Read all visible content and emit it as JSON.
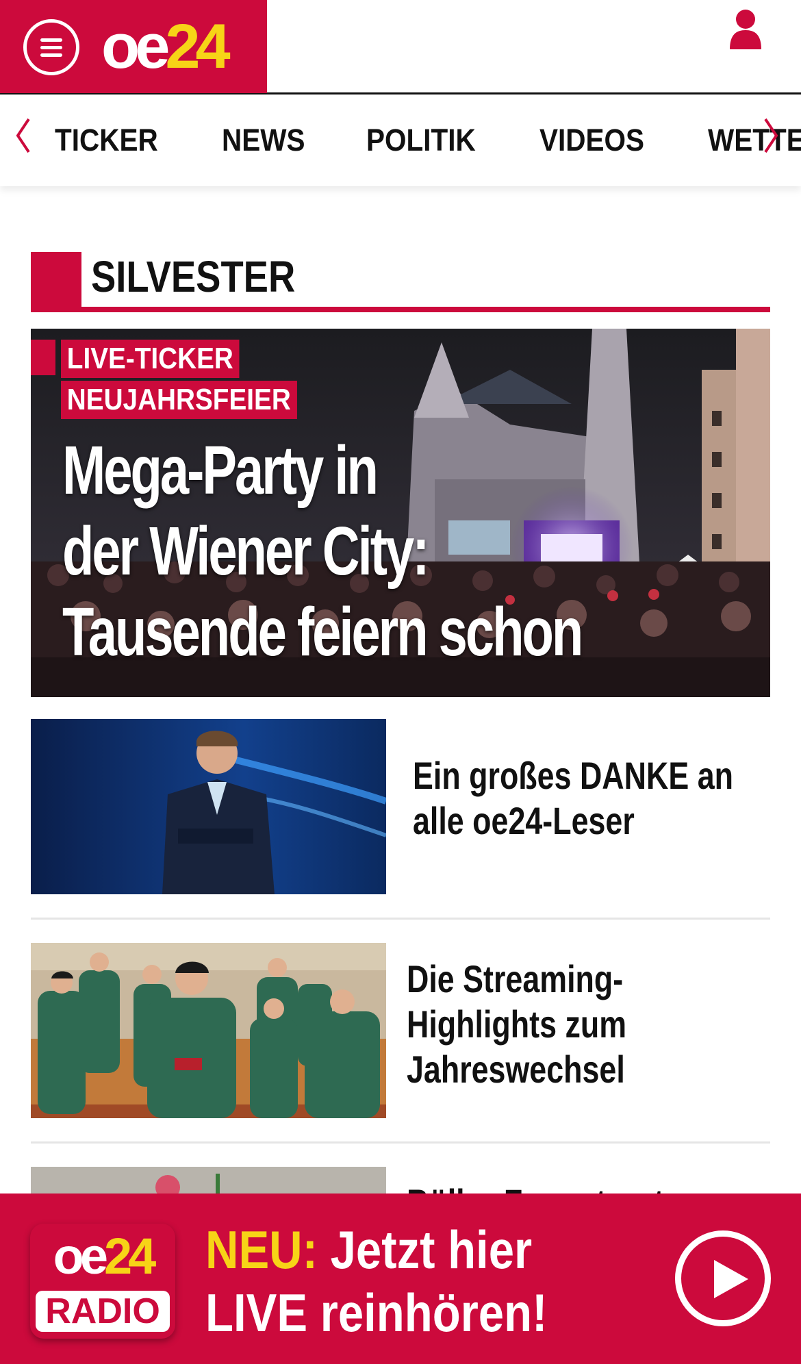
{
  "header": {
    "logo_oe": "oe",
    "logo_24": "24",
    "brand_color": "#cc0a3c",
    "accent_color": "#f7d417",
    "icons": [
      "menu-icon",
      "user-icon"
    ]
  },
  "nav": {
    "items": [
      {
        "label": "TICKER"
      },
      {
        "label": "NEWS"
      },
      {
        "label": "POLITIK"
      },
      {
        "label": "VIDEOS"
      },
      {
        "label": "WETTER"
      }
    ]
  },
  "section": {
    "title": "SILVESTER"
  },
  "hero": {
    "kicker_1": "LIVE-TICKER",
    "kicker_2": "NEUJAHRSFEIER",
    "headline_line1": "Mega-Party in",
    "headline_line2": "der Wiener City:",
    "headline_line3": "Tausende feiern schon"
  },
  "articles": [
    {
      "line1": "Ein großes DANKE an",
      "line2": "alle oe24-Leser",
      "line3": ""
    },
    {
      "line1": "Die Streaming-",
      "line2": "Highlights zum",
      "line3": "Jahreswechsel"
    },
    {
      "line1": "Böller-Feuer treut",
      "line2": "",
      "line3": ""
    }
  ],
  "radio": {
    "logo_oe": "oe",
    "logo_24": "24",
    "logo_label": "RADIO",
    "neu": "NEU:",
    "line1_rest": " Jetzt hier",
    "line2": "LIVE reinhören!"
  }
}
